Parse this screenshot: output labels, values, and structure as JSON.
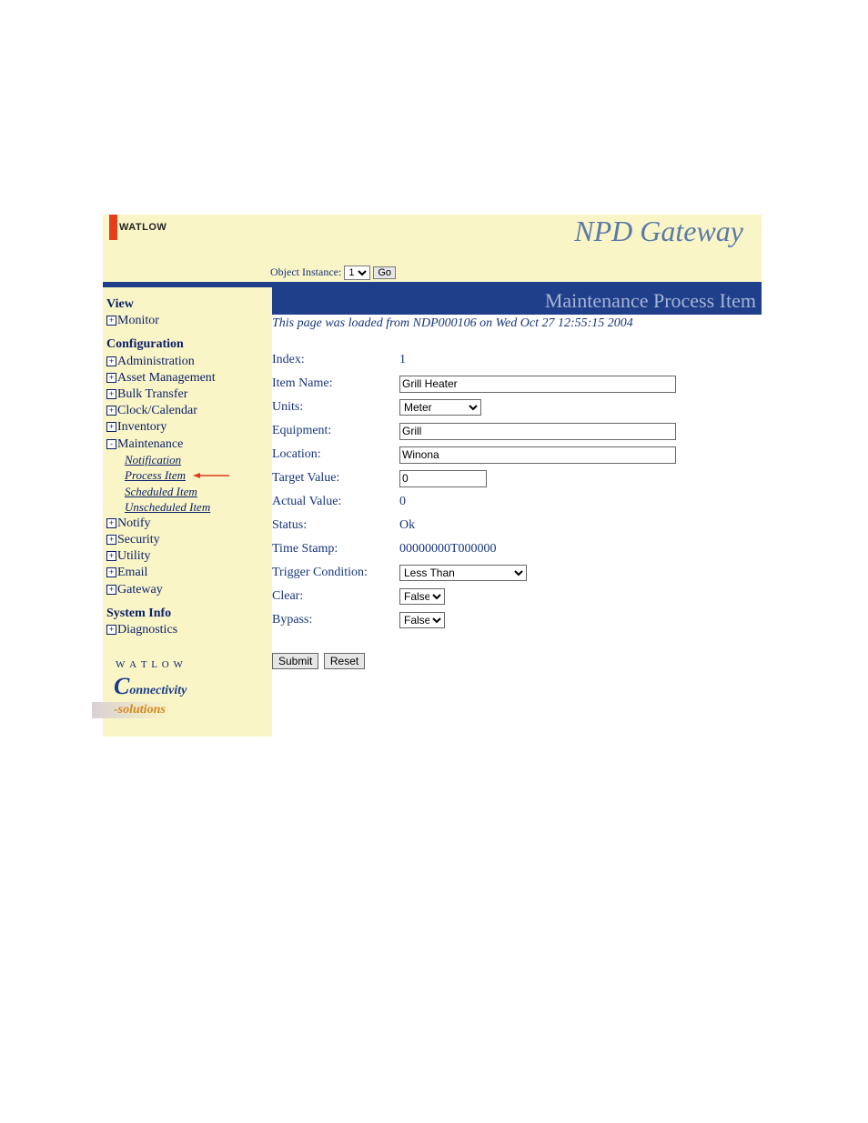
{
  "brand": "WATLOW",
  "app_title": "NPD Gateway",
  "instance": {
    "label": "Object Instance:",
    "value": "1",
    "go": "Go"
  },
  "sidebar": {
    "view_head": "View",
    "monitor": "Monitor",
    "config_head": "Configuration",
    "items": [
      "Administration",
      "Asset Management",
      "Bulk Transfer",
      "Clock/Calendar",
      "Inventory",
      "Maintenance",
      "Notify",
      "Security",
      "Utility",
      "Email",
      "Gateway"
    ],
    "maint_children": [
      "Notification",
      "Process Item",
      "Scheduled Item",
      "Unscheduled Item"
    ],
    "sysinfo_head": "System Info",
    "diagnostics": "Diagnostics"
  },
  "content": {
    "page_title": "Maintenance Process Item",
    "loaded_line": "This page was loaded from NDP000106 on Wed Oct 27 12:55:15 2004",
    "fields": {
      "index_label": "Index:",
      "index_value": "1",
      "item_name_label": "Item Name:",
      "item_name_value": "Grill Heater",
      "units_label": "Units:",
      "units_value": "Meter",
      "equipment_label": "Equipment:",
      "equipment_value": "Grill",
      "location_label": "Location:",
      "location_value": "Winona",
      "target_label": "Target Value:",
      "target_value": "0",
      "actual_label": "Actual Value:",
      "actual_value": "0",
      "status_label": "Status:",
      "status_value": "Ok",
      "timestamp_label": "Time Stamp:",
      "timestamp_value": "00000000T000000",
      "trigger_label": "Trigger Condition:",
      "trigger_value": "Less Than",
      "clear_label": "Clear:",
      "clear_value": "False",
      "bypass_label": "Bypass:",
      "bypass_value": "False"
    },
    "buttons": {
      "submit": "Submit",
      "reset": "Reset"
    }
  }
}
